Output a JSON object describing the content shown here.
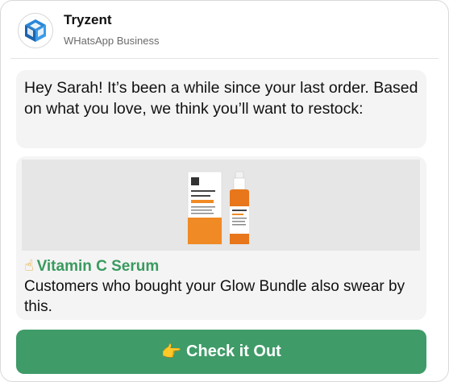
{
  "header": {
    "brand_name": "Tryzent",
    "brand_subtitle": "WHatsApp Business",
    "avatar_icon": "cube-logo-icon"
  },
  "messages": {
    "greeting": "Hey Sarah! It’s been a while since your last order. Based on what you love, we think you’ll want to restock:"
  },
  "product": {
    "image_icon": "serum-bottle-image",
    "title_emoji": "☝",
    "title": "Vitamin C Serum",
    "description": "Customers who bought your Glow Bundle also swear by this."
  },
  "cta": {
    "emoji": "👉",
    "label": "Check it Out"
  },
  "colors": {
    "accent_green": "#3f9b68",
    "title_green": "#3a9a5f",
    "bubble_bg": "#f4f4f4",
    "logo_blue": "#1f78c8"
  }
}
